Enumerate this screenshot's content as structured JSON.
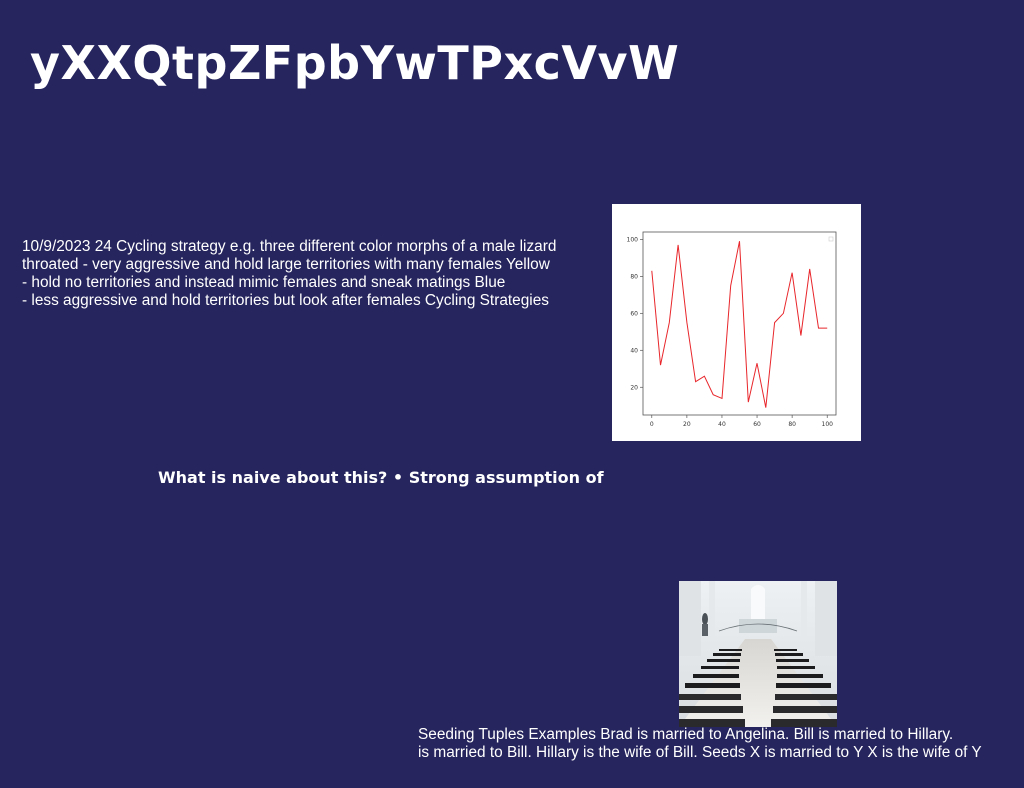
{
  "slide": {
    "title": "yXXQtpZFpbYwTPxcVvW",
    "paragraph1": [
      "10/9/2023 24 Cycling strategy e.g. three different color morphs of a male lizard",
      "throated - very aggressive and hold large territories with many females Yellow",
      "- hold no territories and instead mimic females and sneak matings Blue",
      "- less aggressive and hold territories but look after females Cycling Strategies"
    ],
    "question": "What is naive about this? • Strong assumption of",
    "paragraph2": [
      "Seeding Tuples Examples Brad is married to Angelina. Bill is married to Hillary.",
      "is married to Bill. Hillary is the wife of Bill. Seeds X is married to Y X is the wife of Y"
    ]
  },
  "chart_data": {
    "type": "line",
    "x": [
      0,
      5,
      10,
      15,
      20,
      25,
      30,
      35,
      40,
      45,
      50,
      55,
      60,
      65,
      70,
      75,
      80,
      85,
      90,
      95,
      100
    ],
    "series": [
      {
        "values": [
          83,
          32,
          55,
          97,
          55,
          23,
          26,
          16,
          14,
          75,
          99,
          12,
          33,
          9,
          55,
          60,
          82,
          48,
          84,
          52,
          52
        ],
        "color": "#e8262b"
      }
    ],
    "xticks": [
      0,
      20,
      40,
      60,
      80,
      100
    ],
    "yticks": [
      20,
      40,
      60,
      80,
      100
    ],
    "xlim": [
      -5,
      105
    ],
    "ylim": [
      5,
      104
    ],
    "grid": false,
    "title": "",
    "xlabel": "",
    "ylabel": ""
  },
  "images": {
    "chart_image": "line-plot",
    "photo": "church-interior-with-pews"
  },
  "colors": {
    "background": "#26255e",
    "text": "#ffffff",
    "line": "#e8262b"
  }
}
